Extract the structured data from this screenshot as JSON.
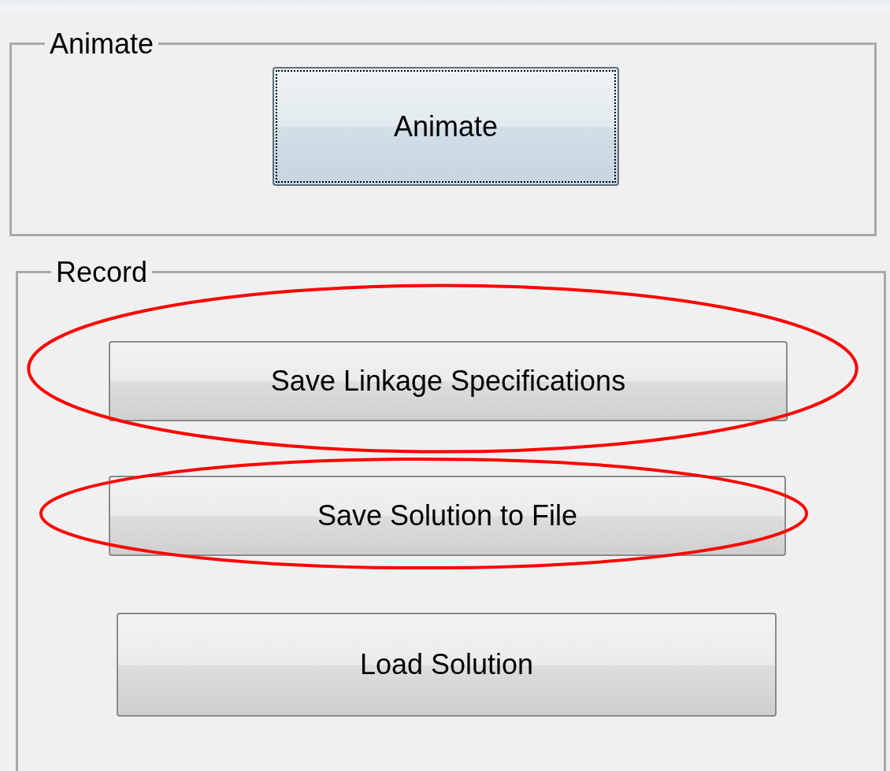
{
  "groups": [
    {
      "title": "Animate",
      "buttons": [
        {
          "label": "Animate",
          "focused": true,
          "highlighted": false
        }
      ]
    },
    {
      "title": "Record",
      "buttons": [
        {
          "label": "Save Linkage Specifications",
          "focused": false,
          "highlighted": true
        },
        {
          "label": "Save Solution to File",
          "focused": false,
          "highlighted": true
        },
        {
          "label": "Load Solution",
          "focused": false,
          "highlighted": false
        }
      ]
    }
  ]
}
